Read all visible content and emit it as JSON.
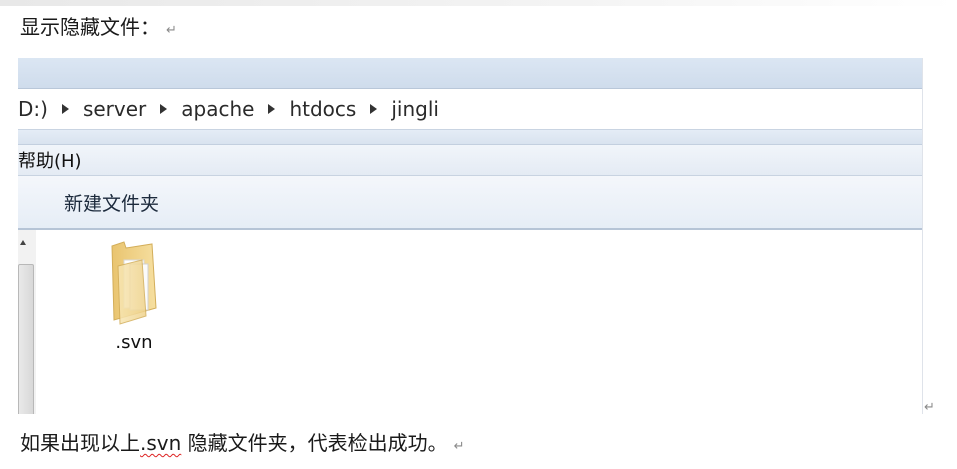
{
  "document": {
    "intro_text": "显示隐藏文件：",
    "result_prefix": "如果出现以上",
    "result_svn": ".svn",
    "result_suffix": " 隐藏文件夹，代表检出成功。",
    "paragraph_mark": "↵"
  },
  "explorer": {
    "breadcrumb": [
      "D:)",
      "server",
      "apache",
      "htdocs",
      "jingli"
    ],
    "menu_label": "帮助(H)",
    "toolbar_new_folder": "新建文件夹",
    "files": [
      {
        "name": ".svn",
        "icon": "folder-icon"
      }
    ]
  },
  "colors": {
    "folder": "#f2d58a",
    "chrome": "#dbe6f3"
  }
}
